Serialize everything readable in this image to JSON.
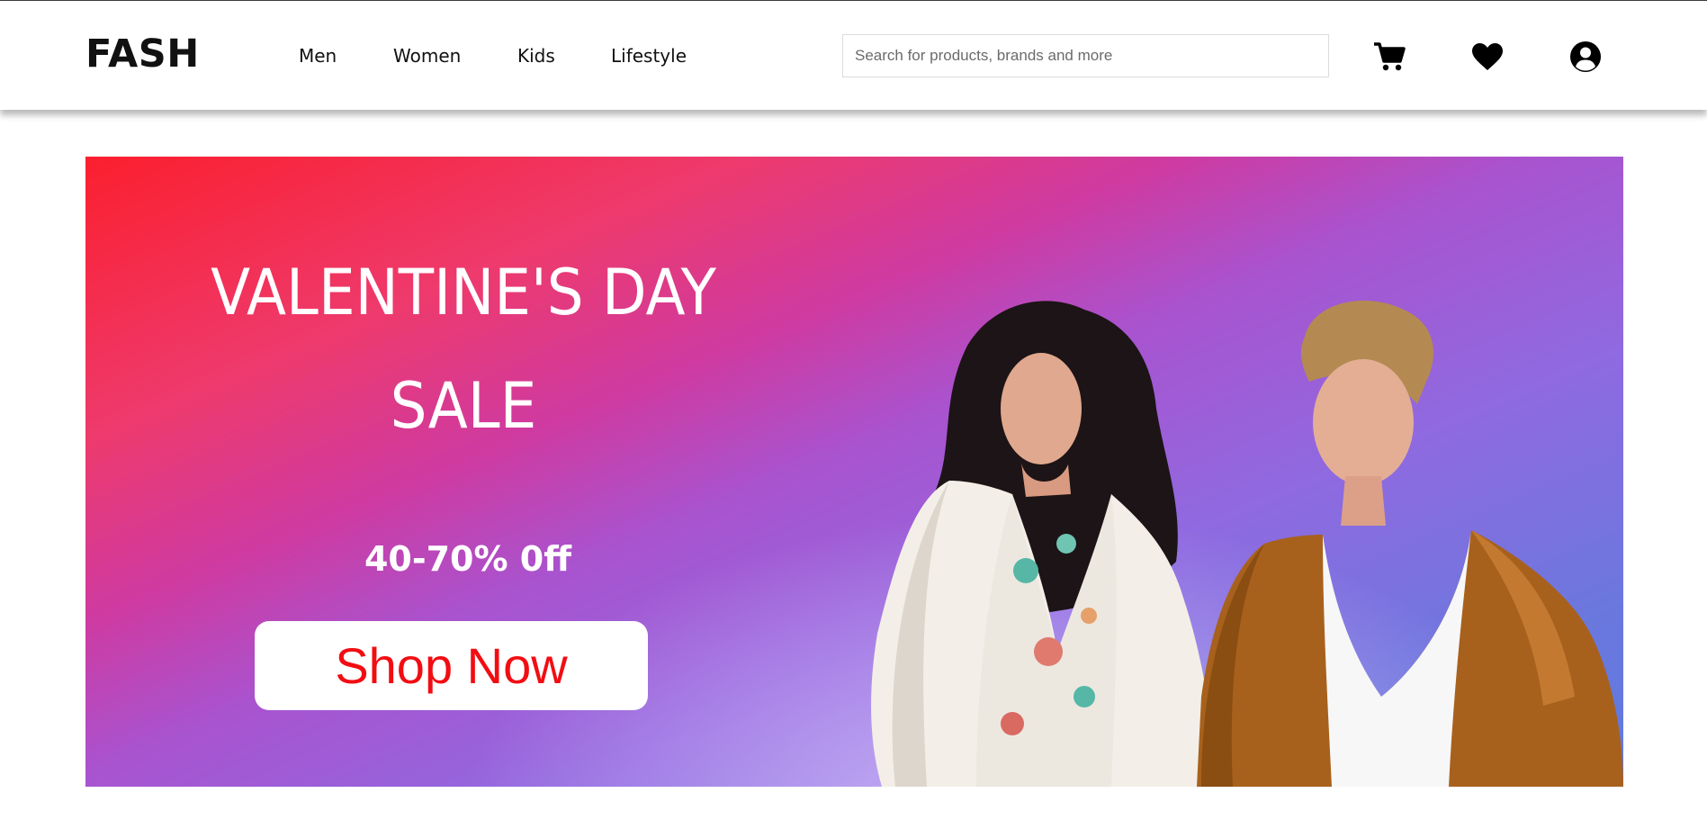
{
  "brand": {
    "logo": "FASH"
  },
  "nav": {
    "links": [
      {
        "label": "Men"
      },
      {
        "label": "Women"
      },
      {
        "label": "Kids"
      },
      {
        "label": "Lifestyle"
      }
    ]
  },
  "search": {
    "placeholder": "Search for products, brands and more",
    "value": ""
  },
  "icons": {
    "cart": "cart-icon",
    "wishlist": "heart-icon",
    "account": "user-circle-icon"
  },
  "banner": {
    "heading_line1": "VALENTINE'S DAY",
    "heading_line2": "SALE",
    "discount": "40-70% 0ff",
    "cta_label": "Shop Now",
    "colors": {
      "gradient_start": "#fb1f2e",
      "gradient_mid": "#a953cf",
      "gradient_end": "#5f7ade",
      "cta_text": "#f20d12"
    }
  }
}
